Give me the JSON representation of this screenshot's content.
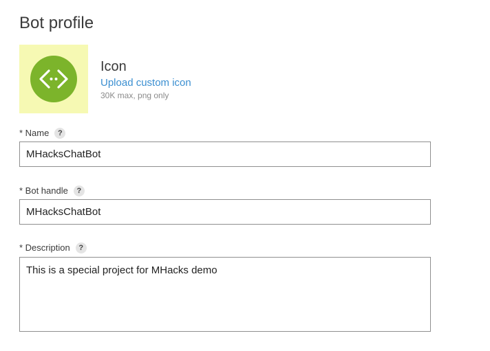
{
  "page": {
    "title": "Bot profile"
  },
  "icon_section": {
    "heading": "Icon",
    "upload_link": "Upload custom icon",
    "hint": "30K max, png only",
    "icon_name": "code-brackets-icon",
    "tile_color": "#f6f9b3",
    "circle_color": "#7cb42b"
  },
  "fields": {
    "name": {
      "label": "* Name",
      "help": "?",
      "value": "MHacksChatBot"
    },
    "handle": {
      "label": "* Bot handle",
      "help": "?",
      "value": "MHacksChatBot"
    },
    "description": {
      "label": "* Description",
      "help": "?",
      "value": "This is a special project for MHacks demo"
    }
  },
  "colors": {
    "link": "#3b8fd1",
    "input_border": "#8e8e8e"
  }
}
